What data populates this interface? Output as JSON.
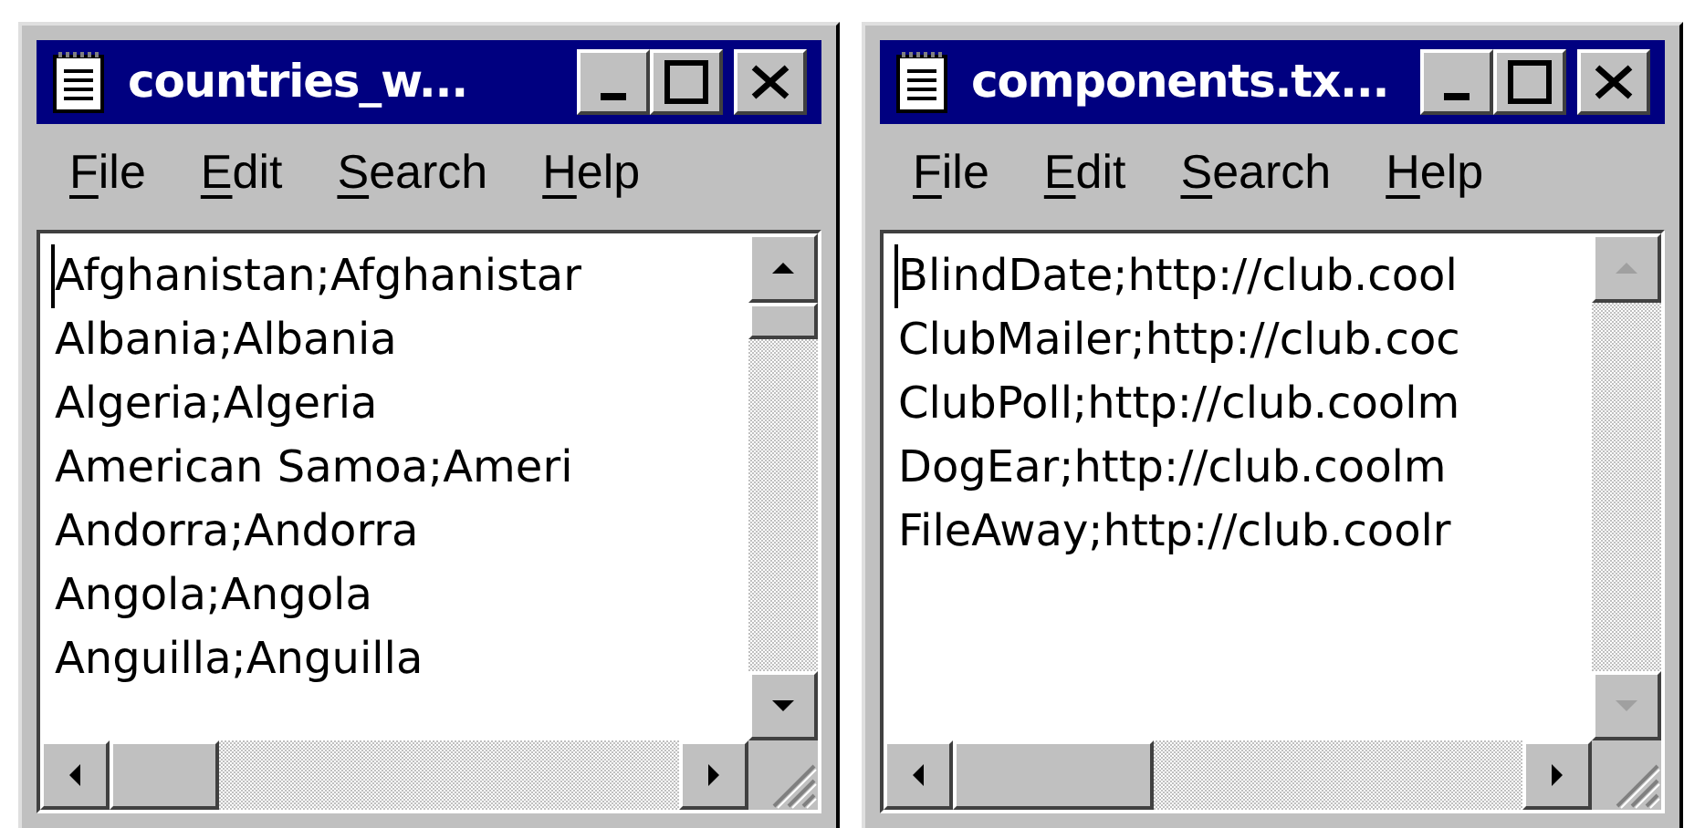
{
  "windows": [
    {
      "title": "countries_w...",
      "menu": [
        "File",
        "Edit",
        "Search",
        "Help"
      ],
      "lines": [
        "Afghanistan;Afghanistar",
        "Albania;Albania",
        "Algeria;Algeria",
        "American Samoa;Ameri",
        "Andorra;Andorra",
        "Angola;Angola",
        "Anguilla;Anguilla"
      ],
      "vertical_scroll_disabled": false
    },
    {
      "title": "components.tx...",
      "menu": [
        "File",
        "Edit",
        "Search",
        "Help"
      ],
      "lines": [
        "BlindDate;http://club.cool",
        "ClubMailer;http://club.coc",
        "ClubPoll;http://club.coolm",
        "DogEar;http://club.coolm",
        "FileAway;http://club.coolr"
      ],
      "vertical_scroll_disabled": true
    }
  ]
}
